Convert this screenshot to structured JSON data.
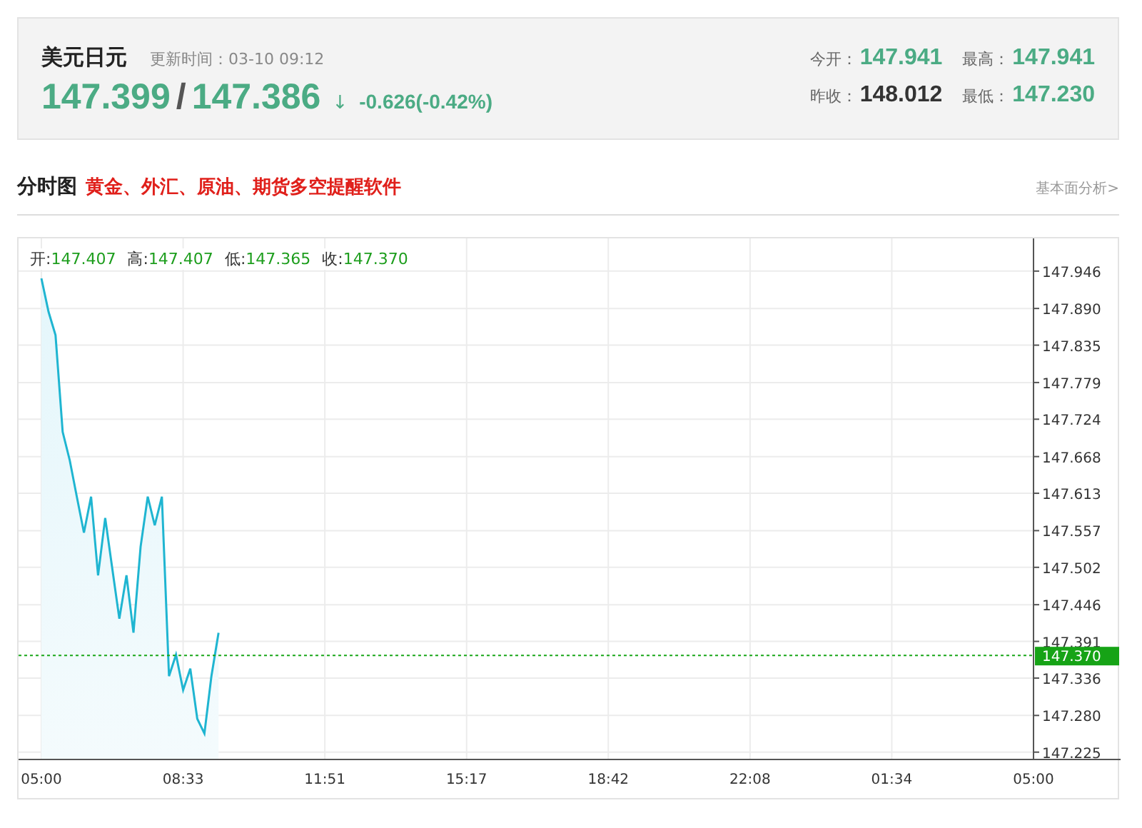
{
  "quote": {
    "name": "美元日元",
    "updated": "更新时间：03-10 09:12",
    "bid": "147.399",
    "separator": "/",
    "ask": "147.386",
    "arrow": "↓",
    "change": "-0.626(-0.42%)"
  },
  "stats": [
    {
      "label": "今开：",
      "value": "147.941",
      "color": "#4bab84"
    },
    {
      "label": "最高：",
      "value": "147.941",
      "color": "#4bab84"
    },
    {
      "label": "昨收：",
      "value": "148.012",
      "color": "#333333"
    },
    {
      "label": "最低：",
      "value": "147.230",
      "color": "#4bab84"
    }
  ],
  "section": {
    "title": "分时图",
    "promo_link": "黄金、外汇、原油、期货多空提醒软件",
    "analysis_link": "基本面分析>"
  },
  "chart": {
    "ohlc": [
      {
        "label": "开:",
        "value": "147.407"
      },
      {
        "label": "高:",
        "value": "147.407"
      },
      {
        "label": "低:",
        "value": "147.365"
      },
      {
        "label": "收:",
        "value": "147.370"
      }
    ],
    "chart_data": {
      "type": "area",
      "categories": [
        "05:00",
        null,
        null,
        null,
        null,
        null,
        null,
        null,
        null,
        null,
        null,
        null,
        null,
        null,
        null,
        null,
        null,
        null,
        null,
        null,
        "08:33",
        null,
        null,
        null,
        null,
        null,
        null,
        null,
        null,
        null,
        null,
        null,
        null,
        null,
        null,
        null,
        null,
        null,
        null,
        null,
        "11:51",
        null,
        null,
        null,
        null,
        null,
        null,
        null,
        null,
        null,
        null,
        null,
        null,
        null,
        null,
        null,
        null,
        null,
        null,
        null,
        "15:17",
        null,
        null,
        null,
        null,
        null,
        null,
        null,
        null,
        null,
        null,
        null,
        null,
        null,
        null,
        null,
        null,
        null,
        null,
        null,
        "18:42",
        null,
        null,
        null,
        null,
        null,
        null,
        null,
        null,
        null,
        null,
        null,
        null,
        null,
        null,
        null,
        null,
        null,
        null,
        null,
        "22:08",
        null,
        null,
        null,
        null,
        null,
        null,
        null,
        null,
        null,
        null,
        null,
        null,
        null,
        null,
        null,
        null,
        null,
        null,
        null,
        "01:34",
        null,
        null,
        null,
        null,
        null,
        null,
        null,
        null,
        null,
        null,
        null,
        null,
        null,
        null,
        null,
        null,
        null,
        null,
        null,
        "05:00"
      ],
      "series": [
        {
          "color": "#1fb5d1",
          "values": [
            147.935,
            147.885,
            147.85,
            147.705,
            147.662,
            147.608,
            147.554,
            147.608,
            147.49,
            147.576,
            147.501,
            147.425,
            147.49,
            147.404,
            147.533,
            147.608,
            147.565,
            147.608,
            147.339,
            147.371,
            147.318,
            147.35,
            147.275,
            147.253,
            147.339,
            147.404,
            null,
            null,
            null,
            null,
            null,
            null,
            null,
            null,
            null,
            null,
            null,
            null,
            null,
            null,
            null,
            null,
            null,
            null,
            null,
            null,
            null,
            null,
            null,
            null,
            null,
            null,
            null,
            null,
            null,
            null,
            null,
            null,
            null,
            null,
            null,
            null,
            null,
            null,
            null,
            null,
            null,
            null,
            null,
            null,
            null,
            null,
            null,
            null,
            null,
            null,
            null,
            null,
            null,
            null,
            null,
            null,
            null,
            null,
            null,
            null,
            null,
            null,
            null,
            null,
            null,
            null,
            null,
            null,
            null,
            null,
            null,
            null,
            null,
            null,
            null,
            null,
            null,
            null,
            null,
            null,
            null,
            null,
            null,
            null,
            null,
            null,
            null,
            null,
            null,
            null,
            null,
            null,
            null,
            null,
            null,
            null,
            null,
            null,
            null,
            null,
            null,
            null,
            null,
            null,
            null,
            null,
            null,
            null,
            null,
            null,
            null,
            null,
            null,
            null,
            null
          ]
        }
      ],
      "ylim": [
        147.214,
        147.995
      ],
      "grid": true,
      "ref_lines": [
        {
          "axis": "y",
          "value": 147.37,
          "label": "147.370"
        }
      ],
      "yticks": [
        {
          "value": 147.946,
          "label": "147.946"
        },
        {
          "value": 147.89,
          "label": "147.890"
        },
        {
          "value": 147.835,
          "label": "147.835"
        },
        {
          "value": 147.779,
          "label": "147.779"
        },
        {
          "value": 147.724,
          "label": "147.724"
        },
        {
          "value": 147.668,
          "label": "147.668"
        },
        {
          "value": 147.613,
          "label": "147.613"
        },
        {
          "value": 147.557,
          "label": "147.557"
        },
        {
          "value": 147.502,
          "label": "147.502"
        },
        {
          "value": 147.446,
          "label": "147.446"
        },
        {
          "value": 147.391,
          "label": "147.391"
        },
        {
          "value": 147.336,
          "label": "147.336"
        },
        {
          "value": 147.28,
          "label": "147.280"
        },
        {
          "value": 147.225,
          "label": "147.225"
        }
      ]
    }
  }
}
